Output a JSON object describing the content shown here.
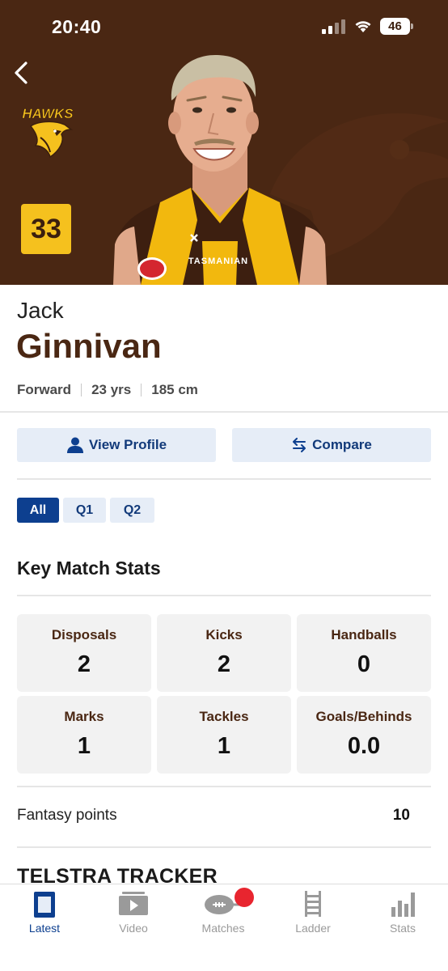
{
  "status_bar": {
    "time": "20:40",
    "battery": "46"
  },
  "hero": {
    "team_logo_text": "HAWKS",
    "jersey_number": "33",
    "guernsey_sponsor": "TASMANIAN"
  },
  "player": {
    "first_name": "Jack",
    "last_name": "Ginnivan",
    "position": "Forward",
    "age": "23 yrs",
    "height": "185 cm"
  },
  "actions": {
    "view_profile": "View Profile",
    "compare": "Compare"
  },
  "tabs": [
    {
      "label": "All",
      "active": true
    },
    {
      "label": "Q1",
      "active": false
    },
    {
      "label": "Q2",
      "active": false
    }
  ],
  "key_stats": {
    "title": "Key Match Stats",
    "items": [
      {
        "label": "Disposals",
        "value": "2"
      },
      {
        "label": "Kicks",
        "value": "2"
      },
      {
        "label": "Handballs",
        "value": "0"
      },
      {
        "label": "Marks",
        "value": "1"
      },
      {
        "label": "Tackles",
        "value": "1"
      },
      {
        "label": "Goals/Behinds",
        "value": "0.0"
      }
    ]
  },
  "fantasy": {
    "label": "Fantasy points",
    "value": "10"
  },
  "tracker": {
    "title": "TELSTRA TRACKER"
  },
  "bottom_nav": [
    {
      "label": "Latest",
      "icon": "latest-icon",
      "active": true
    },
    {
      "label": "Video",
      "icon": "video-icon",
      "active": false
    },
    {
      "label": "Matches",
      "icon": "matches-icon",
      "active": false
    },
    {
      "label": "Ladder",
      "icon": "ladder-icon",
      "active": false
    },
    {
      "label": "Stats",
      "icon": "stats-icon",
      "active": false
    }
  ],
  "colors": {
    "hawks_brown": "#4a2713",
    "hawks_gold": "#f5c11e",
    "accent_blue": "#0d3f8f",
    "button_bg": "#e6edf7",
    "notification_red": "#e8252f"
  }
}
